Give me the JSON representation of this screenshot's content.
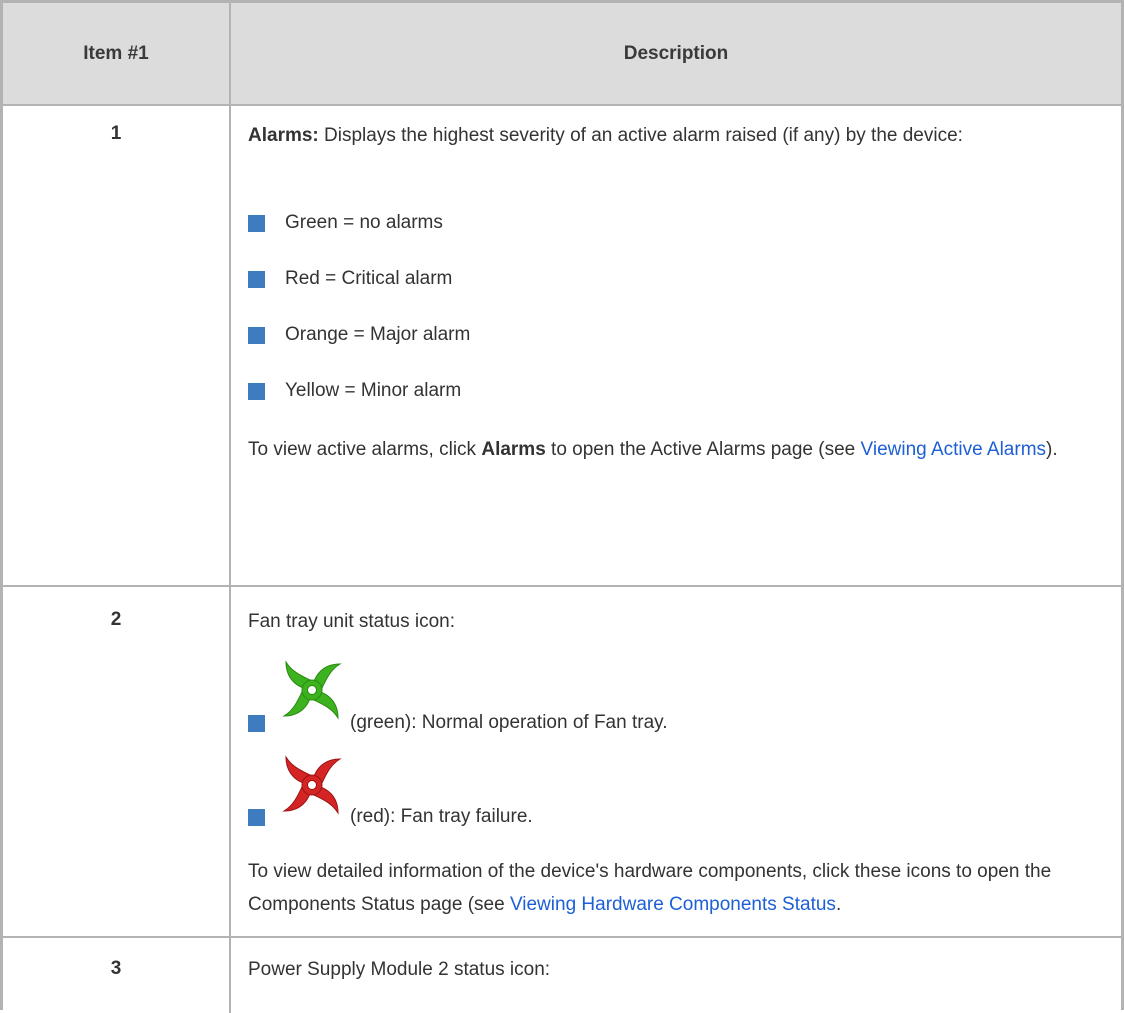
{
  "header": {
    "col1": "Item #1",
    "col2": "Description"
  },
  "rows": [
    {
      "num": "1",
      "lead_bold": "Alarms:",
      "lead_text": " Displays the highest severity of an active alarm raised (if any) by the device:",
      "bullets": [
        "Green = no alarms",
        "Red = Critical alarm",
        "Orange = Major alarm",
        "Yellow = Minor alarm"
      ],
      "note_a": "To view active alarms, click ",
      "note_bold": "Alarms",
      "note_b": " to open the Active Alarms page (see ",
      "note_link": "Viewing Active Alarms",
      "note_c": ")."
    },
    {
      "num": "2",
      "lead": "Fan tray unit status icon:",
      "icon_items": [
        {
          "icon": "fan-green-icon",
          "color": "#3cb21e",
          "text": "(green): Normal operation of Fan tray."
        },
        {
          "icon": "fan-red-icon",
          "color": "#d42424",
          "text": "(red): Fan tray failure."
        }
      ],
      "note_a": "To view detailed information of the device's hardware components, click these icons to open the Components Status page (see ",
      "note_link": "Viewing Hardware Components Status",
      "note_c": "."
    },
    {
      "num": "3",
      "lead": "Power Supply Module 2 status icon:"
    }
  ]
}
